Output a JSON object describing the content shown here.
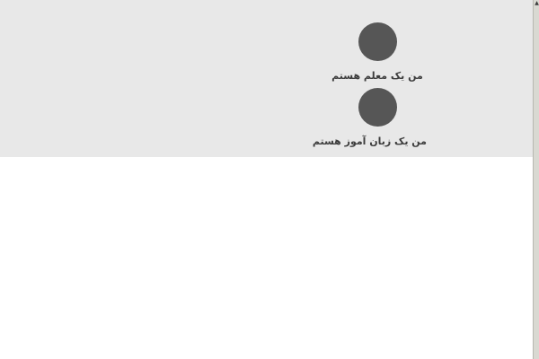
{
  "options": [
    {
      "label": "من یک معلم هستم",
      "icon": "avatar-placeholder"
    },
    {
      "label": "من یک زبان آموز هستم",
      "icon": "avatar-placeholder"
    }
  ],
  "scrollbar": {
    "up_glyph": "▲"
  },
  "colors": {
    "panel_background": "#e8e8e8",
    "avatar": "#565656",
    "label": "#3c3c3c",
    "scrollbar": "#d9d9d2"
  }
}
